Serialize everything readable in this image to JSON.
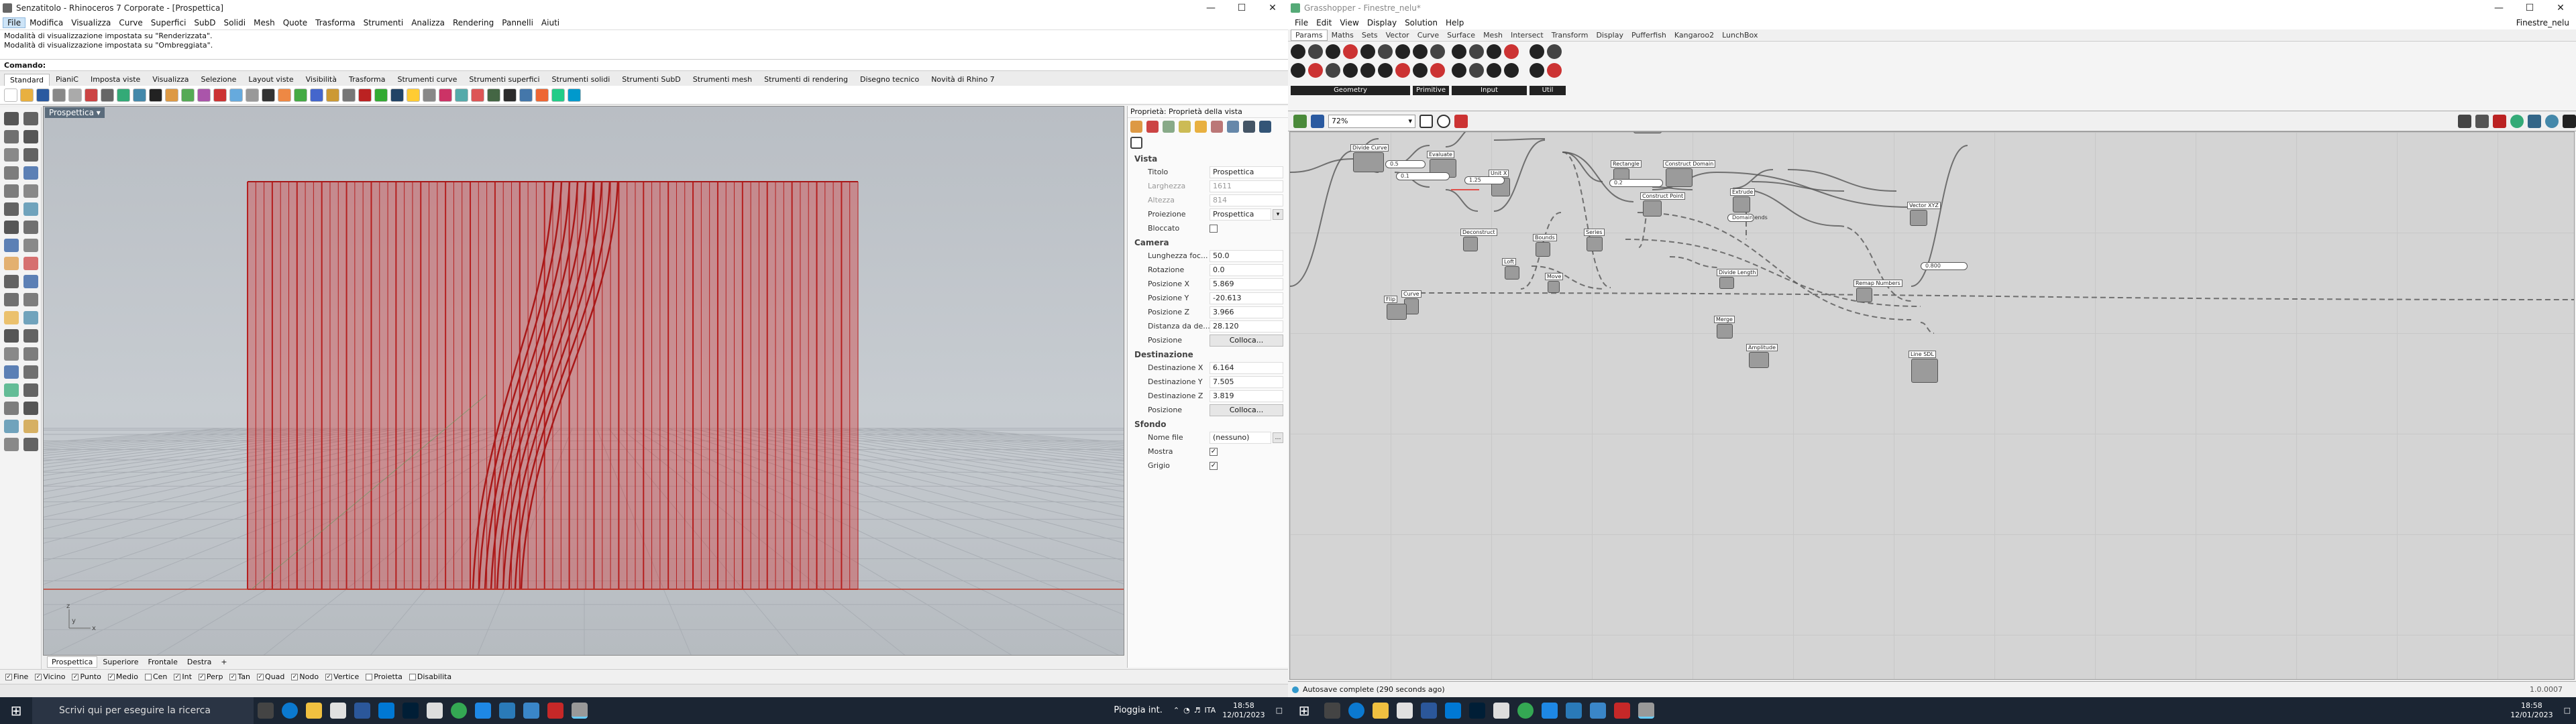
{
  "rhino": {
    "title": "Senzatitolo - Rhinoceros 7 Corporate - [Prospettica]",
    "menu": [
      "File",
      "Modifica",
      "Visualizza",
      "Curve",
      "Superfici",
      "SubD",
      "Solidi",
      "Mesh",
      "Quote",
      "Trasforma",
      "Strumenti",
      "Analizza",
      "Rendering",
      "Pannelli",
      "Aiuti"
    ],
    "history": [
      "Modalità di visualizzazione impostata su \"Renderizzata\".",
      "Modalità di visualizzazione impostata su \"Ombreggiata\"."
    ],
    "command": "Comando:",
    "tabs": [
      "Standard",
      "PianiC",
      "Imposta viste",
      "Visualizza",
      "Selezione",
      "Layout viste",
      "Visibilità",
      "Trasforma",
      "Strumenti curve",
      "Strumenti superfici",
      "Strumenti solidi",
      "Strumenti SubD",
      "Strumenti mesh",
      "Strumenti di rendering",
      "Disegno tecnico",
      "Novità di Rhino 7"
    ],
    "viewport_label": "Prospettica",
    "view_tabs": [
      "Prospettica",
      "Superiore",
      "Frontale",
      "Destra",
      "+"
    ],
    "osnaps": [
      {
        "label": "Fine",
        "checked": true
      },
      {
        "label": "Vicino",
        "checked": true
      },
      {
        "label": "Punto",
        "checked": true
      },
      {
        "label": "Medio",
        "checked": true
      },
      {
        "label": "Cen",
        "checked": false
      },
      {
        "label": "Int",
        "checked": true
      },
      {
        "label": "Perp",
        "checked": true
      },
      {
        "label": "Tan",
        "checked": true
      },
      {
        "label": "Quad",
        "checked": true
      },
      {
        "label": "Nodo",
        "checked": true
      },
      {
        "label": "Vertice",
        "checked": true
      },
      {
        "label": "Proietta",
        "checked": false
      },
      {
        "label": "Disabilita",
        "checked": false
      }
    ],
    "axis": {
      "z": "z",
      "x": "x",
      "y": "y"
    },
    "props": {
      "header": "Proprietà: Proprietà della vista",
      "vista": "Vista",
      "titolo_k": "Titolo",
      "titolo_v": "Prospettica",
      "larghezza_k": "Larghezza",
      "larghezza_v": "1611",
      "altezza_k": "Altezza",
      "altezza_v": "814",
      "proiezione_k": "Proiezione",
      "proiezione_v": "Prospettica",
      "bloccato_k": "Bloccato",
      "camera": "Camera",
      "focale_k": "Lunghezza foc...",
      "focale_v": "50.0",
      "rotazione_k": "Rotazione",
      "rotazione_v": "0.0",
      "posx_k": "Posizione X",
      "posx_v": "5.869",
      "posy_k": "Posizione Y",
      "posy_v": "-20.613",
      "posz_k": "Posizione Z",
      "posz_v": "3.966",
      "dist_k": "Distanza da de...",
      "dist_v": "28.120",
      "pos_k": "Posizione",
      "colloca": "Colloca...",
      "destinazione": "Destinazione",
      "dx_k": "Destinazione X",
      "dx_v": "6.164",
      "dy_k": "Destinazione Y",
      "dy_v": "7.505",
      "dz_k": "Destinazione Z",
      "dz_v": "3.819",
      "sfondo": "Sfondo",
      "nome_k": "Nome file",
      "nome_v": "(nessuno)",
      "mostra_k": "Mostra",
      "grigio_k": "Grigio"
    }
  },
  "gh": {
    "title": "Grasshopper - Finestre_nelu*",
    "doc_name": "Finestre_nelu",
    "menu": [
      "File",
      "Edit",
      "View",
      "Display",
      "Solution",
      "Help"
    ],
    "tabs": [
      "Params",
      "Maths",
      "Sets",
      "Vector",
      "Curve",
      "Surface",
      "Mesh",
      "Intersect",
      "Transform",
      "Display",
      "Pufferfish",
      "Kangaroo2",
      "LunchBox"
    ],
    "groups": [
      "Geometry",
      "Primitive",
      "Input",
      "Util"
    ],
    "zoom": "72%",
    "status": "Autosave complete (290 seconds ago)",
    "version": "1.0.0007",
    "nodes": [
      {
        "label": "Graph Mapper"
      },
      {
        "label": "Divide Curve"
      },
      {
        "label": "Evaluate"
      },
      {
        "label": "Construct Domain"
      },
      {
        "label": "Rectangle"
      },
      {
        "label": "Construct Point"
      },
      {
        "label": "Extrude"
      },
      {
        "label": "Vector XYZ"
      },
      {
        "label": "Amplitude"
      },
      {
        "label": "Line SDL"
      },
      {
        "label": "Remap Numbers"
      },
      {
        "label": "Merge"
      },
      {
        "label": "Bounds"
      },
      {
        "label": "Series"
      },
      {
        "label": "Deconstruct"
      },
      {
        "label": "Move"
      },
      {
        "label": "Curve"
      },
      {
        "label": "Unit X"
      },
      {
        "label": "Unit Y"
      },
      {
        "label": "Flip"
      },
      {
        "label": "Loft"
      },
      {
        "label": "Divide Length"
      }
    ],
    "sliders": [
      {
        "label": "0.5"
      },
      {
        "label": "0.1"
      },
      {
        "label": "1.25"
      },
      {
        "label": "0.2"
      },
      {
        "label": "Domain ends"
      },
      {
        "label": "0.800"
      }
    ]
  },
  "taskbar": {
    "search_placeholder": "Scrivi qui per eseguire la ricerca",
    "weather": "Pioggia int.",
    "lang": "ITA",
    "time_left": "18:58",
    "date_left": "12/01/2023",
    "time_right": "18:58",
    "date_right": "12/01/2023"
  },
  "colors": {
    "accent": "#c0392b",
    "curtain": "#d23030",
    "ghwire": "#555555",
    "taskbar": "#1b2533"
  }
}
